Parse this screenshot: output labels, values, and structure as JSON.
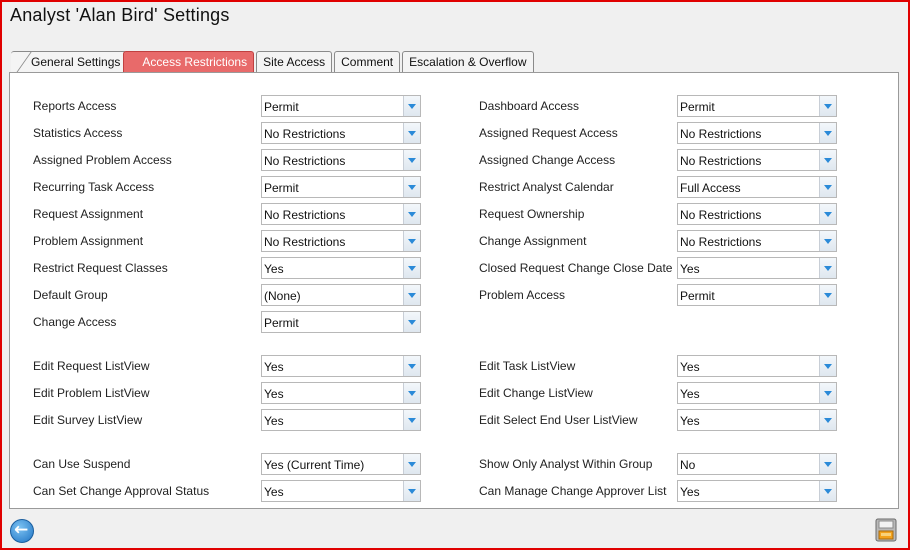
{
  "window": {
    "title": "Analyst 'Alan Bird' Settings"
  },
  "tabs": [
    {
      "label": "General Settings"
    },
    {
      "label": "Access Restrictions"
    },
    {
      "label": "Site Access"
    },
    {
      "label": "Comment"
    },
    {
      "label": "Escalation & Overflow"
    }
  ],
  "left": [
    {
      "label": "Reports Access",
      "value": "Permit"
    },
    {
      "label": "Statistics Access",
      "value": "No Restrictions"
    },
    {
      "label": "Assigned Problem Access",
      "value": "No Restrictions"
    },
    {
      "label": "Recurring Task Access",
      "value": "Permit"
    },
    {
      "label": "Request Assignment",
      "value": "No Restrictions"
    },
    {
      "label": "Problem Assignment",
      "value": "No Restrictions"
    },
    {
      "label": "Restrict Request Classes",
      "value": "Yes"
    },
    {
      "label": "Default Group",
      "value": "(None)"
    },
    {
      "label": "Change Access",
      "value": "Permit"
    },
    {
      "label": "Edit Request ListView",
      "value": "Yes"
    },
    {
      "label": "Edit Problem ListView",
      "value": "Yes"
    },
    {
      "label": "Edit Survey ListView",
      "value": "Yes"
    },
    {
      "label": "Can Use Suspend",
      "value": "Yes (Current Time)"
    },
    {
      "label": "Can Set Change Approval Status",
      "value": "Yes"
    }
  ],
  "right": [
    {
      "label": "Dashboard Access",
      "value": "Permit"
    },
    {
      "label": "Assigned Request Access",
      "value": "No Restrictions"
    },
    {
      "label": "Assigned Change Access",
      "value": "No Restrictions"
    },
    {
      "label": "Restrict Analyst Calendar",
      "value": "Full Access"
    },
    {
      "label": "Request Ownership",
      "value": "No Restrictions"
    },
    {
      "label": "Change Assignment",
      "value": "No Restrictions"
    },
    {
      "label": "Closed Request Change Close Date",
      "value": "Yes"
    },
    {
      "label": "Problem Access",
      "value": "Permit"
    },
    {
      "label": "Edit Task ListView",
      "value": "Yes"
    },
    {
      "label": "Edit Change ListView",
      "value": "Yes"
    },
    {
      "label": "Edit Select End User ListView",
      "value": "Yes"
    },
    {
      "label": "Show Only Analyst Within Group",
      "value": "No"
    },
    {
      "label": "Can Manage Change Approver List",
      "value": "Yes"
    }
  ],
  "icons": {
    "back": "back-arrow-icon",
    "save": "save-disk-icon"
  },
  "colors": {
    "active_tab": "#e86a6a",
    "border": "#e00000",
    "dropdown_arrow": "#2b8ad8"
  }
}
